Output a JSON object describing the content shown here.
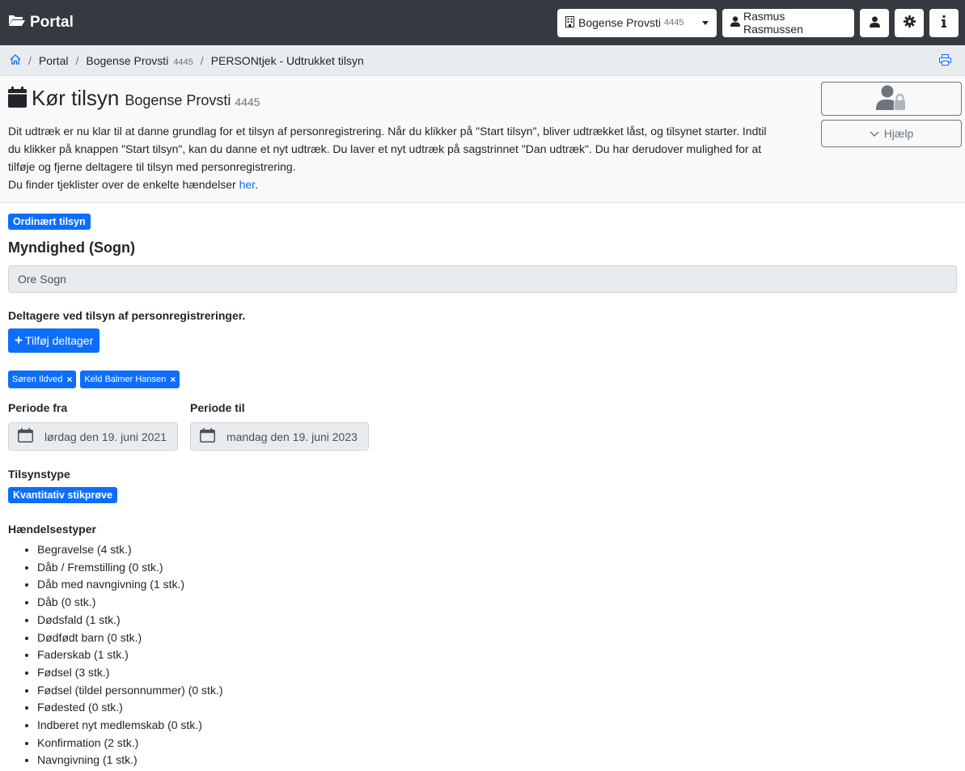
{
  "navbar": {
    "brand": "Portal",
    "org_select": {
      "label": "Bogense Provsti",
      "number": "4445"
    },
    "user": "Rasmus Rasmussen",
    "icons": [
      "user-icon",
      "gear-icon",
      "info-icon"
    ]
  },
  "breadcrumb": {
    "items": [
      {
        "label": "Portal"
      },
      {
        "label": "Bogense Provsti",
        "number": "4445"
      },
      {
        "label": "PERSONtjek - Udtrukket tilsyn"
      }
    ]
  },
  "header": {
    "title": "Kør tilsyn",
    "org": "Bogense Provsti",
    "org_number": "4445",
    "intro_lines": [
      "Dit udtræk er nu klar til at danne grundlag for et tilsyn af personregistrering. Når du klikker på \"Start tilsyn\", bliver udtrækket låst, og tilsynet starter. Indtil",
      "du klikker på knappen \"Start tilsyn\", kan du danne et nyt udtræk. Du laver et nyt udtræk på sagstrinnet \"Dan udtræk\". Du har derudover mulighed for at",
      "tilføje og fjerne deltagere til tilsyn med personregistrering."
    ],
    "intro_last_prefix": "Du finder tjeklister over de enkelte hændelser ",
    "intro_link": "her",
    "intro_last_suffix": ".",
    "help_label": "Hjælp"
  },
  "main": {
    "badge_type": "Ordinært tilsyn",
    "authority_heading": "Myndighed (Sogn)",
    "authority_value": "Ore Sogn",
    "participants_label": "Deltagere ved tilsyn af personregistreringer.",
    "add_participant_label": "Tilføj deltager",
    "participants": [
      "Søren Ildved",
      "Keld Balmer Hansen"
    ],
    "period_from_label": "Periode fra",
    "period_from_value": "lørdag den 19. juni 2021",
    "period_to_label": "Periode til",
    "period_to_value": "mandag den 19. juni 2023",
    "inspection_type_label": "Tilsynstype",
    "inspection_type_value": "Kvantitativ stikprøve",
    "event_types_label": "Hændelsestyper",
    "event_types": [
      "Begravelse (4 stk.)",
      "Dåb / Fremstilling (0 stk.)",
      "Dåb med navngivning (1 stk.)",
      "Dåb (0 stk.)",
      "Dødsfald (1 stk.)",
      "Dødfødt barn (0 stk.)",
      "Faderskab (1 stk.)",
      "Fødsel (3 stk.)",
      "Fødsel (tildel personnummer) (0 stk.)",
      "Fødested (0 stk.)",
      "Indberet nyt medlemskab (0 stk.)",
      "Konfirmation (2 stk.)",
      "Navngivning (1 stk.)"
    ]
  },
  "colors": {
    "navbar_bg": "#343a40",
    "primary": "#0d6efd",
    "breadcrumb_bg": "#e9ecef",
    "header_bg": "#f8f9fa"
  }
}
